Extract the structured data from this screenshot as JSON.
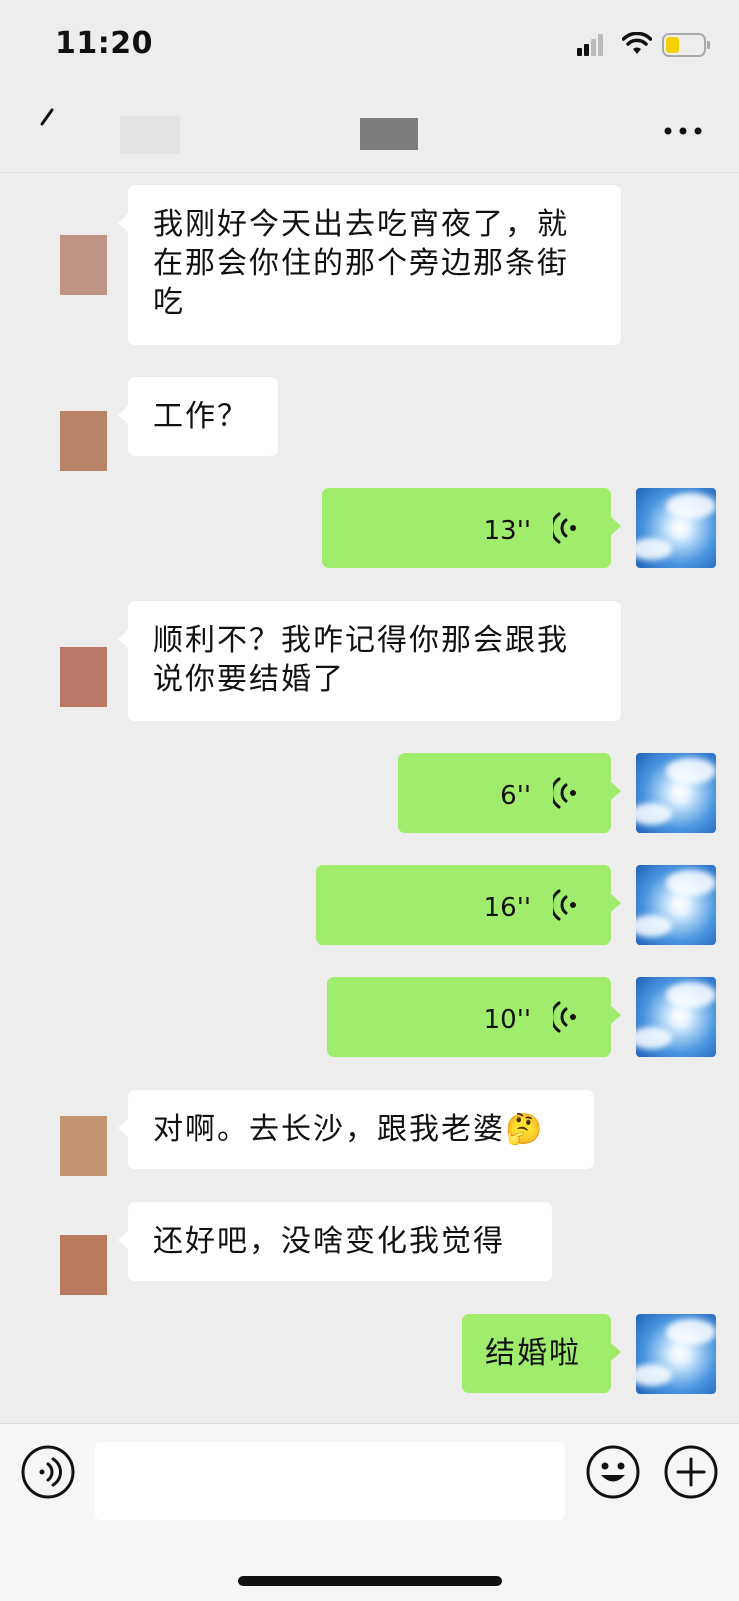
{
  "status_bar": {
    "time": "11:20"
  },
  "chat": {
    "messages": [
      {
        "side": "left",
        "type": "text",
        "text": "我刚好今天出去吃宵夜了，就在那会你住的那个旁边那条街吃"
      },
      {
        "side": "left",
        "type": "text",
        "text": "工作？"
      },
      {
        "side": "right",
        "type": "voice",
        "duration": "13''"
      },
      {
        "side": "left",
        "type": "text",
        "text": "顺利不？我咋记得你那会跟我说你要结婚了"
      },
      {
        "side": "right",
        "type": "voice",
        "duration": "6''"
      },
      {
        "side": "right",
        "type": "voice",
        "duration": "16''"
      },
      {
        "side": "right",
        "type": "voice",
        "duration": "10''"
      },
      {
        "side": "left",
        "type": "text",
        "text": "对啊。去长沙，跟我老婆",
        "emoji": "🤔"
      },
      {
        "side": "left",
        "type": "text",
        "text": "还好吧，没啥变化我觉得"
      },
      {
        "side": "right",
        "type": "text",
        "text": "结婚啦"
      }
    ]
  },
  "input_bar": {
    "placeholder": ""
  },
  "icons": {
    "signal": "signal-icon",
    "wifi": "wifi-icon",
    "battery": "battery-icon",
    "back": "back-icon",
    "more": "more-icon",
    "voice_toggle": "voice-toggle-icon",
    "emoji": "emoji-icon",
    "plus": "plus-icon",
    "voice_wave": "voice-wave-icon"
  },
  "colors": {
    "background": "#ededed",
    "sent_bubble": "#a0ec6c",
    "received_bubble": "#ffffff",
    "battery_level": "#f5d000"
  },
  "battery_level": 0.35
}
